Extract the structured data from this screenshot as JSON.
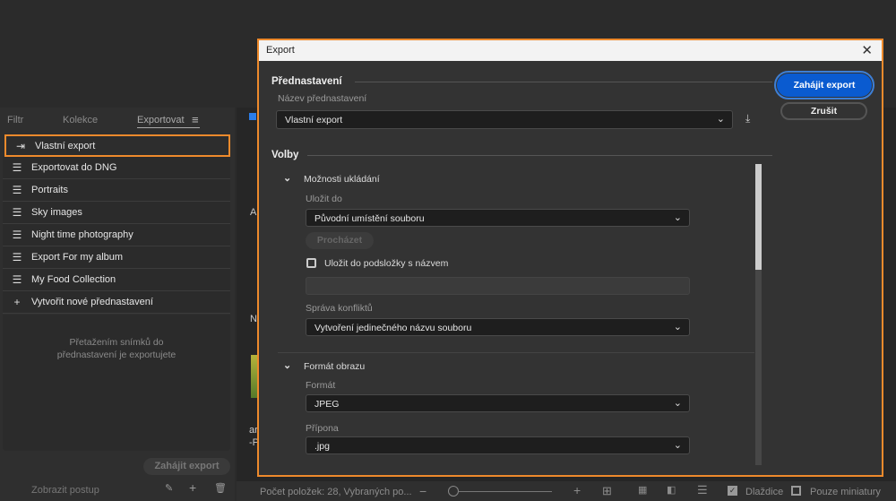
{
  "left_panel": {
    "tabs": [
      "Filtr",
      "Kolekce",
      "Exportovat"
    ],
    "presets": [
      {
        "label": "Vlastní export",
        "icon": "export-icon"
      },
      {
        "label": "Exportovat do DNG",
        "icon": "list-icon"
      },
      {
        "label": "Portraits",
        "icon": "list-icon"
      },
      {
        "label": "Sky images",
        "icon": "list-icon"
      },
      {
        "label": "Night time photography",
        "icon": "list-icon"
      },
      {
        "label": "Export For my album",
        "icon": "list-icon"
      },
      {
        "label": "My Food Collection",
        "icon": "list-icon"
      }
    ],
    "create_preset": "Vytvořit nové přednastavení",
    "hint_line1": "Přetažením snímků do",
    "hint_line2": "přednastavení je exportujete",
    "start_export": "Zahájit export",
    "show_progress": "Zobrazit postup"
  },
  "background": {
    "letters": [
      "A",
      "N",
      "ar",
      "-P"
    ]
  },
  "status_bar": {
    "count_text": "Počet položek: 28, Vybraných po...",
    "tiles_label": "Dlaždice",
    "tiles_checked": true,
    "thumbs_only_label": "Pouze miniatury",
    "thumbs_only_checked": false
  },
  "dialog": {
    "title": "Export",
    "preset_heading": "Přednastavení",
    "preset_name_label": "Název přednastavení",
    "preset_value": "Vlastní export",
    "start_button": "Zahájit export",
    "cancel_button": "Zrušit",
    "options_heading": "Volby",
    "save_section": "Možnosti ukládání",
    "save_to_label": "Uložit do",
    "save_to_value": "Původní umístění souboru",
    "browse_button": "Procházet",
    "subfolder_label": "Uložit do podsložky s názvem",
    "subfolder_checked": false,
    "subfolder_value": "",
    "conflict_label": "Správa konfliktů",
    "conflict_value": "Vytvoření jedinečného názvu souboru",
    "format_section": "Formát obrazu",
    "format_label": "Formát",
    "format_value": "JPEG",
    "ext_label": "Přípona",
    "ext_value": ".jpg",
    "accent": "#0a5bd0",
    "highlight": "#ee8a2c"
  }
}
